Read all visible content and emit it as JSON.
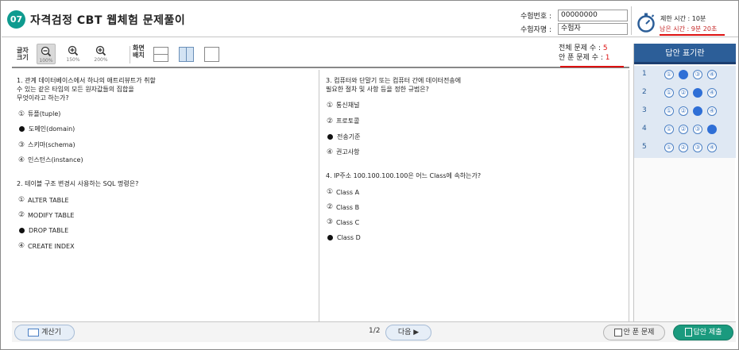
{
  "header": {
    "badge": "07",
    "title": "자격검정 CBT 웹체험 문제풀이",
    "exam_no_label": "수험번호 :",
    "exam_no_value": "00000000",
    "examinee_label": "수험자명 :",
    "examinee_value": "수험자",
    "time_limit": "제한 시간 : 10분",
    "time_left_label": "남은 시간 :",
    "time_left_value": "9분 20초",
    "accent": "#0f9b8f"
  },
  "toolbar": {
    "font_size_label_1": "글자",
    "font_size_label_2": "크기",
    "zoom_100": "100%",
    "zoom_150": "150%",
    "zoom_200": "200%",
    "layout_label_1": "화면",
    "layout_label_2": "배치",
    "total_label": "전체 문제 수 :",
    "total_value": "5",
    "unsolved_label": "안 푼 문제 수 :",
    "unsolved_value": "1"
  },
  "questions": [
    {
      "lines": [
        "1.  관계  데이터베이스에서  하나의  애트리뷰트가  취할",
        "    수  있는  같은  타입의  모든  원자값들의  집합을",
        "    무엇이라고 하는가?"
      ],
      "options": [
        {
          "mark": "①",
          "text": "튜플(tuple)",
          "selected": false
        },
        {
          "mark": "●",
          "text": "도메인(domain)",
          "selected": true
        },
        {
          "mark": "③",
          "text": "스키마(schema)",
          "selected": false
        },
        {
          "mark": "④",
          "text": "인스턴스(instance)",
          "selected": false
        }
      ]
    },
    {
      "lines": [
        "2.  테이블 구조 변경시 사용하는 SQL 명령은?"
      ],
      "options": [
        {
          "mark": "①",
          "text": "ALTER TABLE",
          "selected": false
        },
        {
          "mark": "②",
          "text": "MODIFY TABLE",
          "selected": false
        },
        {
          "mark": "●",
          "text": "DROP TABLE",
          "selected": true
        },
        {
          "mark": "④",
          "text": "CREATE INDEX",
          "selected": false
        }
      ]
    },
    {
      "lines": [
        "3.  컴퓨터와 단말기 또는 컴퓨터 간에 데이터전송에",
        "    필요한 절차 및 사항 등을 정한 규범은?"
      ],
      "options": [
        {
          "mark": "①",
          "text": "통신채널",
          "selected": false
        },
        {
          "mark": "②",
          "text": "프로토콜",
          "selected": false
        },
        {
          "mark": "●",
          "text": "전송기준",
          "selected": true
        },
        {
          "mark": "④",
          "text": "권고사항",
          "selected": false
        }
      ]
    },
    {
      "lines": [
        "4.  IP주소 100.100.100.100은 어느 Class에 속하는가?"
      ],
      "options": [
        {
          "mark": "①",
          "text": "Class A",
          "selected": false
        },
        {
          "mark": "②",
          "text": "Class B",
          "selected": false
        },
        {
          "mark": "③",
          "text": "Class C",
          "selected": false
        },
        {
          "mark": "●",
          "text": "Class D",
          "selected": true
        }
      ]
    }
  ],
  "answer_panel": {
    "title": "답안 표기란",
    "rows": [
      {
        "num": "1",
        "marks": [
          "①",
          "●",
          "③",
          "④"
        ],
        "selected": 2
      },
      {
        "num": "2",
        "marks": [
          "①",
          "②",
          "●",
          "④"
        ],
        "selected": 3
      },
      {
        "num": "3",
        "marks": [
          "①",
          "②",
          "●",
          "④"
        ],
        "selected": 3
      },
      {
        "num": "4",
        "marks": [
          "①",
          "②",
          "③",
          "●"
        ],
        "selected": 4
      },
      {
        "num": "5",
        "marks": [
          "①",
          "②",
          "③",
          "④"
        ],
        "selected": 0
      }
    ],
    "header_color": "#2c5e98",
    "selected_color": "#2f6fd6"
  },
  "footer": {
    "calc_label": "계산기",
    "page": "1/2",
    "next_label": "다음 ▶",
    "unsolved_label": "안 푼 문제",
    "submit_label": "답안 제출"
  }
}
